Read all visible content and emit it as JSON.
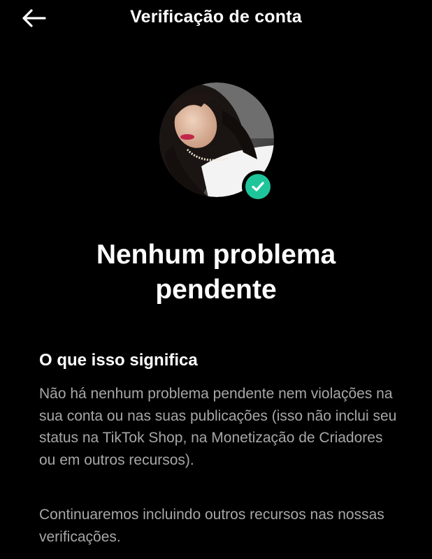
{
  "header": {
    "back_icon": "arrow-left-icon",
    "title": "Verificação de conta"
  },
  "profile": {
    "avatar": "profile-photo",
    "badge_icon": "check-icon",
    "badge_color": "#1fc59a"
  },
  "status": {
    "title": "Nenhum problema pendente"
  },
  "section": {
    "heading": "O que isso significa",
    "paragraph_1": "Não há nenhum problema pendente nem violações na sua conta ou nas suas publicações (isso não inclui seu status na TikTok Shop, na Monetização de Criadores ou em outros recursos).",
    "paragraph_2": "Continuaremos incluindo outros recursos nas nossas verificações."
  }
}
